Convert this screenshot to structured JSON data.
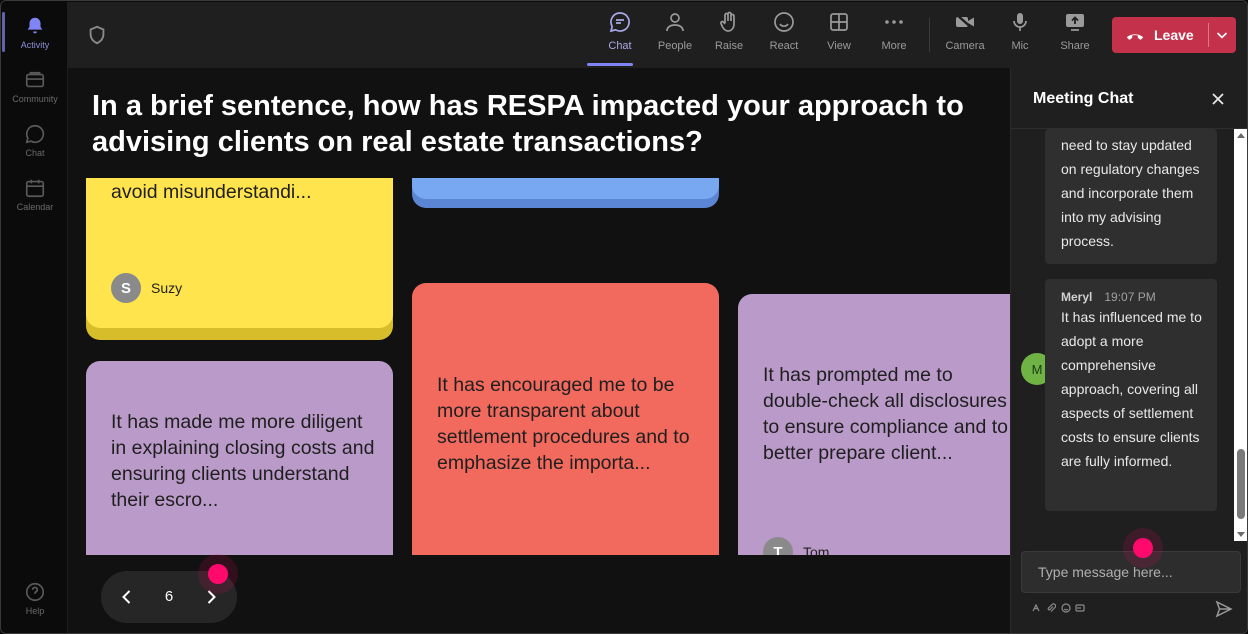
{
  "rail": {
    "items": [
      {
        "label": "Activity"
      },
      {
        "label": "Community"
      },
      {
        "label": "Chat"
      },
      {
        "label": "Calendar"
      },
      {
        "label": "Help"
      }
    ]
  },
  "toolbar": {
    "chat": "Chat",
    "people": "People",
    "raise": "Raise",
    "react": "React",
    "view": "View",
    "more": "More",
    "camera": "Camera",
    "mic": "Mic",
    "share": "Share",
    "leave": "Leave"
  },
  "stage": {
    "question": "In a brief sentence, how has RESPA impacted your approach to advising clients on real estate transactions?",
    "notes": [
      {
        "text": "avoid misunderstandi...",
        "author": "Suzy",
        "initial": "S",
        "color": "#ffe44d"
      },
      {
        "text": "",
        "color": "#79a8f2"
      },
      {
        "text": "It has made me more diligent in explaining closing costs and ensuring clients understand their escro...",
        "color": "#b99ac9"
      },
      {
        "text": "It has encouraged me to be more transparent about settlement procedures and to emphasize the importa...",
        "color": "#f26a5e"
      },
      {
        "text": "It has prompted me to double-check all disclosures to ensure compliance and to better prepare client...",
        "author": "Tom",
        "initial": "T",
        "color": "#b99ac9"
      }
    ],
    "pager": {
      "page": "6"
    }
  },
  "chat": {
    "title": "Meeting Chat",
    "messages": [
      {
        "text": "need to stay updated on regulatory changes and incorporate them into my advising process."
      },
      {
        "sender": "Meryl",
        "initial": "M",
        "time": "19:07 PM",
        "text": "It has influenced me to adopt a more comprehensive approach, covering all aspects of settlement costs to ensure clients are fully informed."
      }
    ],
    "placeholder": "Type message here..."
  }
}
